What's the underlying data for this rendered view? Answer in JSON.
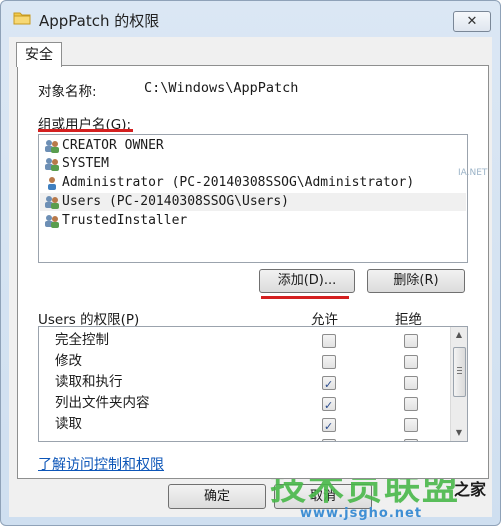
{
  "window": {
    "title": "AppPatch 的权限",
    "close_label": "✕"
  },
  "tab": {
    "label": "安全"
  },
  "object": {
    "label": "对象名称:",
    "value": "C:\\Windows\\AppPatch"
  },
  "group": {
    "label": "组或用户名(G):",
    "users": [
      {
        "name": "CREATOR OWNER",
        "icon": "group-icon"
      },
      {
        "name": "SYSTEM",
        "icon": "group-icon"
      },
      {
        "name": "Administrator (PC-20140308SSOG\\Administrator)",
        "icon": "user-icon"
      },
      {
        "name": "Users (PC-20140308SSOG\\Users)",
        "icon": "group-icon",
        "selected": true
      },
      {
        "name": "TrustedInstaller",
        "icon": "group-icon"
      }
    ]
  },
  "buttons": {
    "add": "添加(D)...",
    "remove": "删除(R)",
    "ok": "确定",
    "cancel": "取消"
  },
  "permissions": {
    "header": "Users 的权限(P)",
    "allow_header": "允许",
    "deny_header": "拒绝",
    "rows": [
      {
        "name": "完全控制",
        "allow": false,
        "deny": false
      },
      {
        "name": "修改",
        "allow": false,
        "deny": false
      },
      {
        "name": "读取和执行",
        "allow": true,
        "deny": false
      },
      {
        "name": "列出文件夹内容",
        "allow": true,
        "deny": false
      },
      {
        "name": "读取",
        "allow": true,
        "deny": false
      },
      {
        "name": "",
        "allow": false,
        "deny": false
      }
    ]
  },
  "link": {
    "label": "了解访问控制和权限"
  },
  "watermark": {
    "big": "技术员联盟",
    "small": "之家",
    "url": "www.jsgho.net",
    "faint": "IA.NET"
  },
  "colors": {
    "underline": "#d42020",
    "link": "#0d56b8",
    "watermark_green": "#49b84a"
  }
}
